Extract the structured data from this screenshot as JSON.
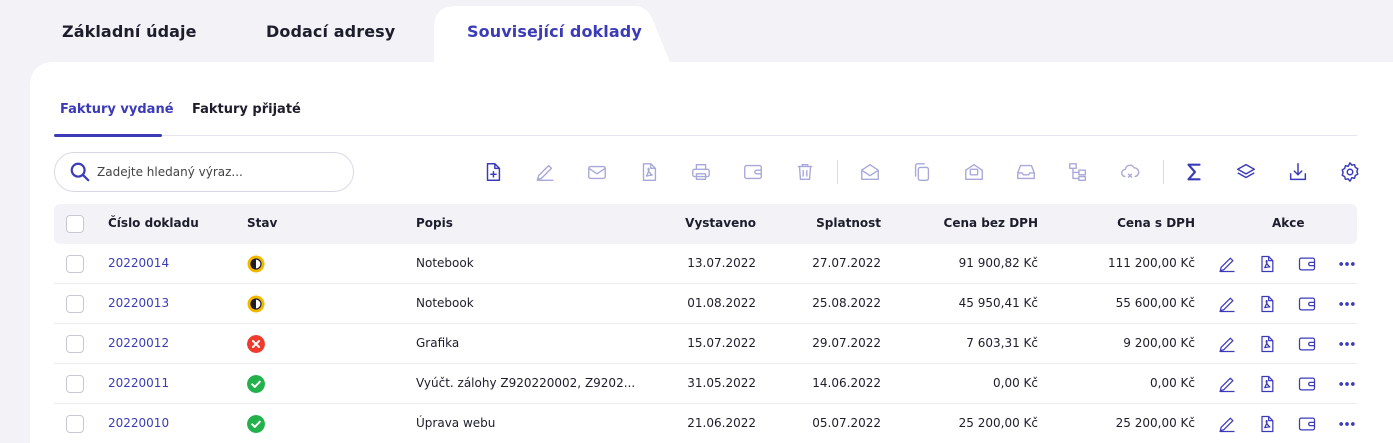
{
  "top_tabs": [
    "Základní údaje",
    "Dodací adresy",
    "Související doklady"
  ],
  "sub_tabs": [
    "Faktury vydané",
    "Faktury přijaté"
  ],
  "search": {
    "placeholder": "Zadejte hledaný výraz..."
  },
  "toolbar_icons": [
    "add-document-icon",
    "edit-icon",
    "mail-icon",
    "pdf-icon",
    "print-icon",
    "wallet-icon",
    "delete-icon",
    "open-mail-icon",
    "copy-icon",
    "envelope-archive-icon",
    "inbox-tray-icon",
    "hierarchy-icon",
    "cloud-sync-icon",
    "sum-icon",
    "layers-icon",
    "download-icon",
    "settings-icon"
  ],
  "table": {
    "headers": {
      "number": "Číslo dokladu",
      "status": "Stav",
      "description": "Popis",
      "issued": "Vystaveno",
      "due": "Splatnost",
      "price_net": "Cena bez DPH",
      "price_gross": "Cena s DPH",
      "actions": "Akce"
    },
    "rows": [
      {
        "number": "20220014",
        "status": "partial",
        "description": "Notebook",
        "issued": "13.07.2022",
        "due": "27.07.2022",
        "price_net": "91 900,82 Kč",
        "price_gross": "111 200,00 Kč"
      },
      {
        "number": "20220013",
        "status": "partial",
        "description": "Notebook",
        "issued": "01.08.2022",
        "due": "25.08.2022",
        "price_net": "45 950,41 Kč",
        "price_gross": "55 600,00 Kč"
      },
      {
        "number": "20220012",
        "status": "unpaid",
        "description": "Grafika",
        "issued": "15.07.2022",
        "due": "29.07.2022",
        "price_net": "7 603,31 Kč",
        "price_gross": "9 200,00 Kč"
      },
      {
        "number": "20220011",
        "status": "paid",
        "description": "Vyúčt. zálohy Z920220002, Z9202...",
        "issued": "31.05.2022",
        "due": "14.06.2022",
        "price_net": "0,00 Kč",
        "price_gross": "0,00 Kč"
      },
      {
        "number": "20220010",
        "status": "paid",
        "description": "Úprava webu",
        "issued": "21.06.2022",
        "due": "05.07.2022",
        "price_net": "25 200,00 Kč",
        "price_gross": "25 200,00 Kč"
      }
    ]
  },
  "colors": {
    "accent": "#3b3bb8",
    "partial": "#f5b800",
    "unpaid": "#ef3b2d",
    "paid": "#22b14c"
  }
}
